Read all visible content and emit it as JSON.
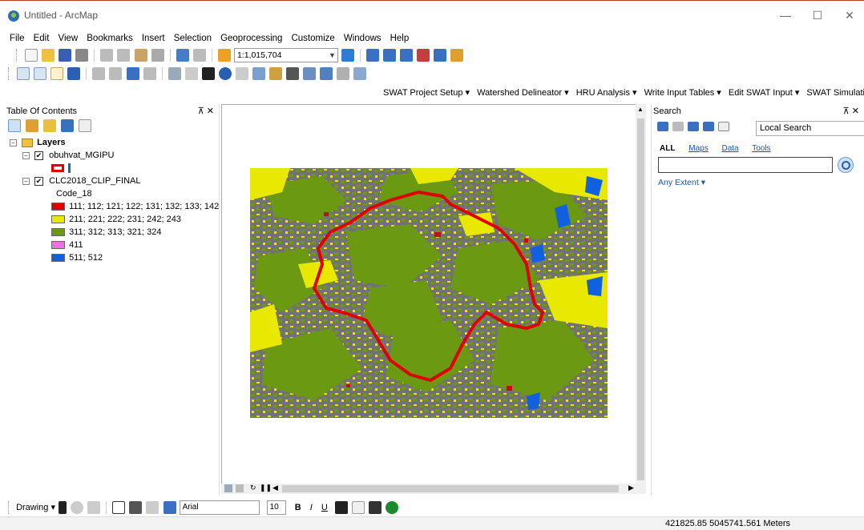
{
  "window": {
    "title": "Untitled - ArcMap",
    "minimize": "—",
    "maximize": "☐",
    "close": "✕"
  },
  "menu": [
    "File",
    "Edit",
    "View",
    "Bookmarks",
    "Insert",
    "Selection",
    "Geoprocessing",
    "Customize",
    "Windows",
    "Help"
  ],
  "standard_toolbar": {
    "scale": "1:1,015,704"
  },
  "swat_toolbar": [
    "SWAT Project Setup ▾",
    "Watershed Delineator ▾",
    "HRU Analysis ▾",
    "Write Input Tables ▾",
    "Edit SWAT Input ▾",
    "SWAT Simulation ▾"
  ],
  "toc": {
    "title": "Table Of Contents",
    "pin": "⊼ ✕",
    "layers_label": "Layers",
    "layer1": "obuhvat_MGIPU",
    "layer2": "CLC2018_CLIP_FINAL",
    "field": "Code_18",
    "classes": [
      {
        "label": "111; 112; 121; 122; 131; 132; 133; 142",
        "color": "#e00000"
      },
      {
        "label": "211; 221; 222; 231; 242; 243",
        "color": "#e8e800"
      },
      {
        "label": "311; 312; 313; 321; 324",
        "color": "#6b9a12"
      },
      {
        "label": "411",
        "color": "#ee70d8"
      },
      {
        "label": "511; 512",
        "color": "#1060e0"
      }
    ],
    "boundary_color": "#e00000"
  },
  "search": {
    "title": "Search",
    "pin": "⊼ ✕",
    "scope": "Local Search",
    "tabs": {
      "all": "ALL",
      "maps": "Maps",
      "data": "Data",
      "tools": "Tools"
    },
    "input_value": "",
    "extent": "Any Extent ▾"
  },
  "drawing_toolbar": {
    "label": "Drawing ▾",
    "font": "Arial",
    "font_size": "10",
    "bold": "B",
    "italic": "I",
    "underline": "U"
  },
  "status": {
    "coordinates": "421825.85  5045741.561 Meters"
  }
}
